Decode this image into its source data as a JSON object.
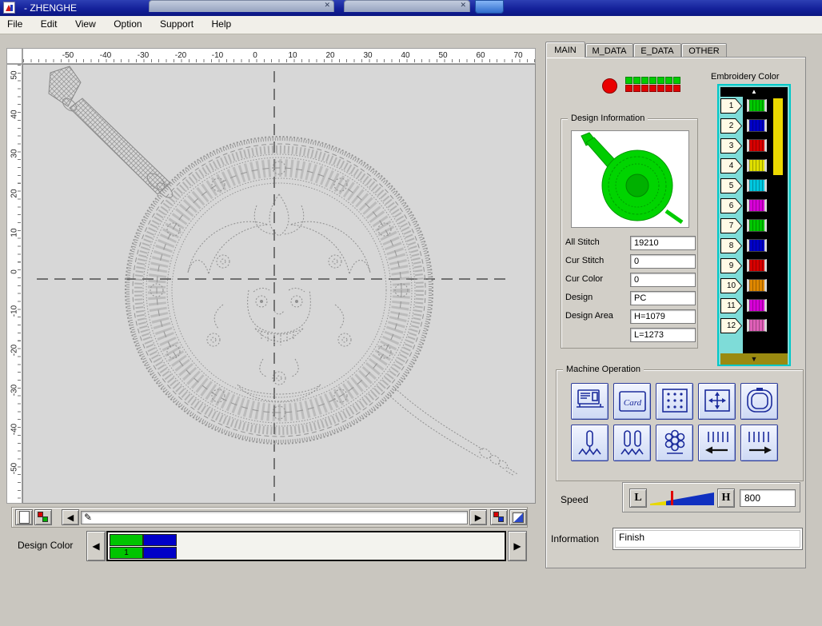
{
  "window": {
    "title": "- ZHENGHE",
    "menu": [
      "File",
      "Edit",
      "View",
      "Option",
      "Support",
      "Help"
    ]
  },
  "icons": {
    "left_arrow": "◀",
    "right_arrow": "▶",
    "up_arrow": "▲",
    "down_arrow": "▼",
    "pencil": "✎",
    "close": "✕"
  },
  "rulers": {
    "top": [
      "-50",
      "-40",
      "-30",
      "-20",
      "-10",
      "0",
      "10",
      "20",
      "30",
      "40",
      "50",
      "60",
      "70"
    ],
    "left": [
      "50",
      "40",
      "30",
      "20",
      "10",
      "0",
      "-10",
      "-20",
      "-30",
      "-40",
      "-50"
    ]
  },
  "design_color": {
    "label": "Design Color",
    "rows": [
      [
        {
          "color": "#00c400",
          "label": ""
        },
        {
          "color": "#0000c8",
          "label": ""
        }
      ],
      [
        {
          "color": "#00c400",
          "label": "1"
        },
        {
          "color": "#0000c8",
          "label": ""
        }
      ]
    ]
  },
  "tabs": [
    "MAIN",
    "M_DATA",
    "E_DATA",
    "OTHER"
  ],
  "status": {
    "led_green": "#00cc00",
    "led_red": "#e00000"
  },
  "design_info": {
    "title": "Design Information",
    "rows": [
      {
        "label": "All Stitch",
        "value": "19210"
      },
      {
        "label": "Cur Stitch",
        "value": "0"
      },
      {
        "label": "Cur Color",
        "value": "0"
      },
      {
        "label": "Design",
        "value": "PC"
      },
      {
        "label": "Design Area",
        "value": "H=1079"
      },
      {
        "label": "",
        "value": "L=1273"
      }
    ]
  },
  "embroidery": {
    "title": "Embroidery Color",
    "items": [
      {
        "num": "1",
        "color": "#00c800"
      },
      {
        "num": "2",
        "color": "#0000c8"
      },
      {
        "num": "3",
        "color": "#d80000"
      },
      {
        "num": "4",
        "color": "#e0e000"
      },
      {
        "num": "5",
        "color": "#00c8e0"
      },
      {
        "num": "6",
        "color": "#d800d8"
      },
      {
        "num": "7",
        "color": "#00c800"
      },
      {
        "num": "8",
        "color": "#0000c8"
      },
      {
        "num": "9",
        "color": "#d80000"
      },
      {
        "num": "10",
        "color": "#e08800"
      },
      {
        "num": "11",
        "color": "#d800d8"
      },
      {
        "num": "12",
        "color": "#e060b8"
      }
    ]
  },
  "machine": {
    "title": "Machine Operation",
    "card_label": "Card",
    "button_icons": [
      "machine-icon",
      "card-icon",
      "design-pattern-icon",
      "frame-origin-icon",
      "hoop-icon",
      "needle-single-icon",
      "needle-double-icon",
      "flower-rotate-icon",
      "needle-bar-left-icon",
      "needle-bar-right-icon"
    ]
  },
  "speed": {
    "label": "Speed",
    "low": "L",
    "high": "H",
    "value": "800"
  },
  "information": {
    "label": "Information",
    "value": "Finish"
  }
}
